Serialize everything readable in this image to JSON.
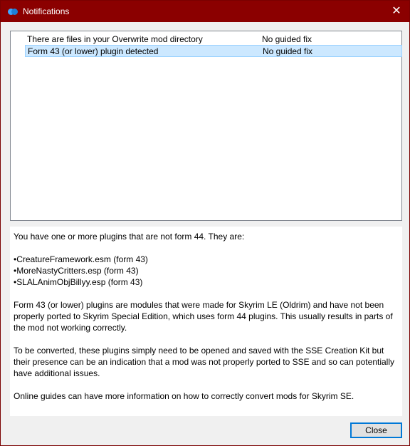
{
  "window": {
    "title": "Notifications",
    "close_glyph": "✕"
  },
  "notifications": {
    "rows": [
      {
        "message": "There are files in your Overwrite mod directory",
        "fix": "No guided fix",
        "selected": false
      },
      {
        "message": "Form 43 (or lower) plugin detected",
        "fix": "No guided fix",
        "selected": true
      }
    ]
  },
  "description": {
    "intro": "You have one or more plugins that are not form 44. They are:",
    "plugins": [
      "CreatureFramework.esm (form 43)",
      "MoreNastyCritters.esp (form 43)",
      "SLALAnimObjBillyy.esp (form 43)"
    ],
    "para1": "Form 43 (or lower) plugins are modules that were made for Skyrim LE (Oldrim) and have not been properly ported to Skyrim Special Edition, which uses form 44 plugins. This usually results in parts of the mod not working correctly.",
    "para2": "To be converted, these plugins simply need to be opened and saved with the SSE Creation Kit but their presence can be an indication that a mod was not properly ported to SSE and so can potentially have additional issues.",
    "para3": "Online guides can have more information on how to correctly convert mods for Skyrim SE."
  },
  "footer": {
    "close_label": "Close"
  },
  "colors": {
    "titlebar": "#8b0000",
    "selection": "#cce8ff",
    "accent": "#0078d7"
  },
  "icons": {
    "app": "mod-organizer-icon",
    "close": "close-icon"
  }
}
